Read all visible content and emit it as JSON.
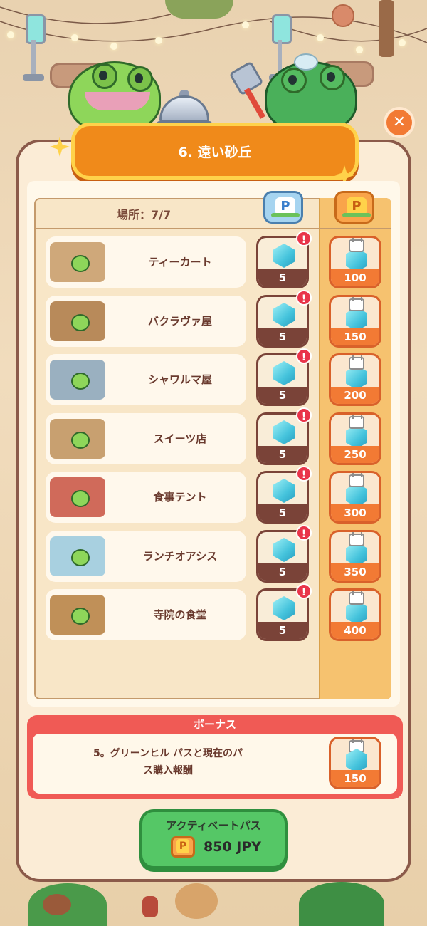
{
  "title": "6. 遠い砂丘",
  "places_label": "場所：7/7",
  "free_pass_letter": "P",
  "premium_pass_letter": "P",
  "close_symbol": "✕",
  "alert_symbol": "!",
  "locations": [
    {
      "name": "ティーカート",
      "free_reward": "5",
      "premium_reward": "100"
    },
    {
      "name": "バクラヴァ屋",
      "free_reward": "5",
      "premium_reward": "150"
    },
    {
      "name": "シャワルマ屋",
      "free_reward": "5",
      "premium_reward": "200"
    },
    {
      "name": "スイーツ店",
      "free_reward": "5",
      "premium_reward": "250"
    },
    {
      "name": "食事テント",
      "free_reward": "5",
      "premium_reward": "300"
    },
    {
      "name": "ランチオアシス",
      "free_reward": "5",
      "premium_reward": "350"
    },
    {
      "name": "寺院の食堂",
      "free_reward": "5",
      "premium_reward": "400"
    }
  ],
  "bonus": {
    "title": "ボーナス",
    "text_line1": "5。グリーンヒル パスと現在のパ",
    "text_line2": "ス購入報酬",
    "reward": "150"
  },
  "activate": {
    "label": "アクティベートパス",
    "price": "850 JPY",
    "pass_letter": "P"
  },
  "colors": {
    "accent_orange": "#f08a1a",
    "free_dark": "#7a4338",
    "premium_orange": "#f27a34",
    "gem_blue": "#45c3dc",
    "bonus_red": "#f05a55",
    "button_green": "#55c766"
  }
}
